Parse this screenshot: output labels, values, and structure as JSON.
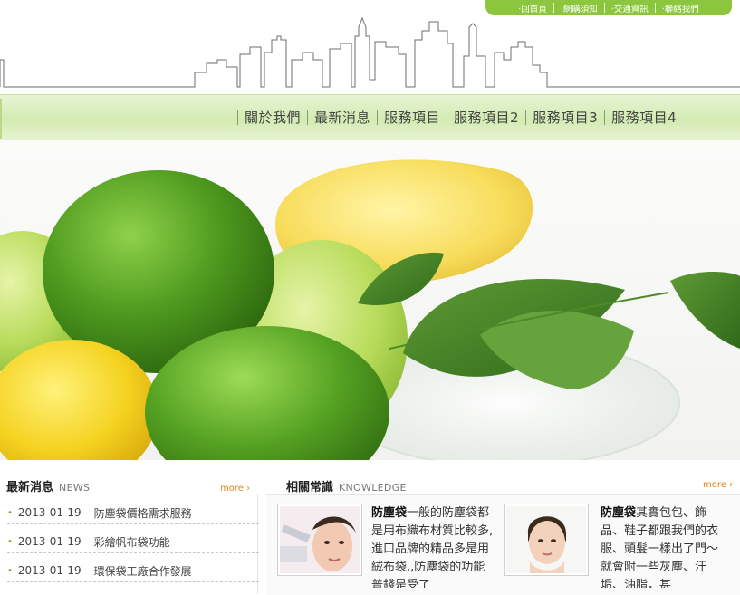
{
  "top_nav": {
    "items": [
      "‧回首頁",
      "‧網購須知",
      "‧交通資訊",
      "‧聯絡我們"
    ]
  },
  "main_nav": {
    "items": [
      "關於我們",
      "最新消息",
      "服務項目",
      "服務項目2",
      "服務項目3",
      "服務項目4"
    ]
  },
  "news": {
    "title": "最新消息",
    "title_en": "NEWS",
    "more": "more ›",
    "items": [
      {
        "date": "2013-01-19",
        "title": "防塵袋價格需求服務"
      },
      {
        "date": "2013-01-19",
        "title": "彩繪帆布袋功能"
      },
      {
        "date": "2013-01-19",
        "title": "環保袋工廠合作發展"
      }
    ]
  },
  "knowledge": {
    "title": "相關常識",
    "title_en": "KNOWLEDGE",
    "more": "more ›",
    "articles": [
      {
        "keyword": "防塵袋",
        "text": "一般的防塵袋都是用布織布材質比較多,進口品牌的精品多是用絨布袋,,防塵袋的功能普錢是受了"
      },
      {
        "keyword": "防塵袋",
        "text": "其實包包、飾品、鞋子都跟我們的衣服、頭髮一樣出了門～就會附一些灰塵、汗垢、油脂，甚"
      }
    ]
  },
  "colors": {
    "accent_green": "#8cc63f",
    "more_orange": "#e0861a"
  }
}
